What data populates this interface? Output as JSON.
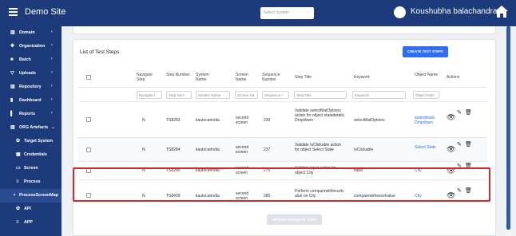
{
  "header": {
    "site_title": "Demo Site",
    "select_system_placeholder": "Select System",
    "user_name": "Koushubha balachandra"
  },
  "sidebar": {
    "items": [
      {
        "label": "Domain",
        "icon": "bank-icon"
      },
      {
        "label": "Organization",
        "icon": "sitemap-icon"
      },
      {
        "label": "Batch",
        "icon": "folder-icon"
      },
      {
        "label": "Uploads",
        "icon": "filter-icon"
      },
      {
        "label": "Repository",
        "icon": "bank-icon"
      },
      {
        "label": "Dashboard",
        "icon": "bar-chart-icon"
      },
      {
        "label": "Reports",
        "icon": "file-icon"
      },
      {
        "label": "ORG Artefacts",
        "icon": "bank-icon"
      },
      {
        "label": "Target System",
        "icon": "gear-icon"
      },
      {
        "label": "Credentials",
        "icon": "lock-icon"
      },
      {
        "label": "Screen",
        "icon": "monitor-icon"
      },
      {
        "label": "Process",
        "icon": "list-icon"
      },
      {
        "label": "ProcessScreenMap",
        "icon": "dot-icon"
      },
      {
        "label": "API",
        "icon": "gear-icon"
      },
      {
        "label": "APP",
        "icon": "list-icon"
      }
    ]
  },
  "card": {
    "title": "List of Test Steps",
    "create_button": "CREATE TEST STEPS",
    "update_button": "UPDATE NAVIGATE STEP"
  },
  "table": {
    "headers": [
      "Navigate Step",
      "Step Number",
      "System Name",
      "Screen Name",
      "Sequence Number",
      "Step Title",
      "Keyword",
      "Object Name",
      "Actions"
    ],
    "filters": [
      "Navigate I",
      "Step Num",
      "System Name",
      "Screen Na",
      "Sequence I",
      "Step Title",
      "Keyword",
      "Object Nam"
    ],
    "rows": [
      {
        "navigate": "N",
        "step": "TS8283",
        "system": "kautocarindia",
        "screen": "second screen",
        "sequence": "236",
        "title": "Validate selectMatOptions action for object statedetails Dropdown",
        "keyword": "selectMatOptions",
        "object": "statedetails Dropdown"
      },
      {
        "navigate": "N",
        "step": "TS8284",
        "system": "kautocarindia",
        "screen": "second screen",
        "sequence": "237",
        "title": "Validate IsClickable action for object Select State",
        "keyword": "IsClickable",
        "object": "Select State"
      },
      {
        "navigate": "N",
        "step": "TS8285",
        "system": "kautocarindia",
        "screen": "second screen",
        "sequence": "275",
        "title": "Validate input action for object City",
        "keyword": "input",
        "object": "City"
      },
      {
        "navigate": "N",
        "step": "TS8409",
        "system": "kautocarindia",
        "screen": "second screen",
        "sequence": "285",
        "title": "Perform comparewithexcelvalue on City",
        "keyword": "comparewithexcelvalue",
        "object": "City"
      }
    ]
  },
  "colors": {
    "nav": "#1d3a7a",
    "accent": "#2f6df2",
    "highlight": "#d92626"
  }
}
